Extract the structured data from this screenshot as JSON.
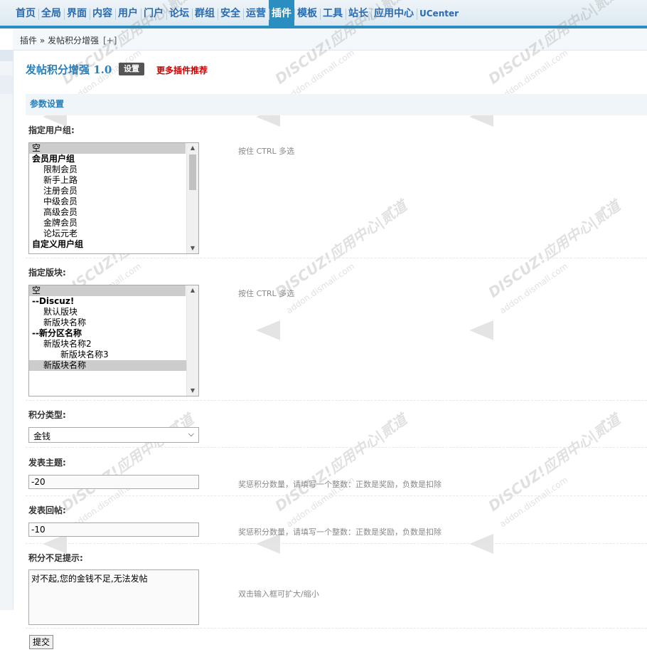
{
  "nav": {
    "items": [
      "首页",
      "全局",
      "界面",
      "内容",
      "用户",
      "门户",
      "论坛",
      "群组",
      "安全",
      "运营",
      "插件",
      "模板",
      "工具",
      "站长",
      "应用中心",
      "UCenter"
    ],
    "active": "插件"
  },
  "breadcrumb": {
    "text": "插件 » 发帖积分增强",
    "plus": "[+]"
  },
  "header": {
    "title": "发帖积分增强 1.0",
    "settings_button": "设置",
    "more_link": "更多插件推荐"
  },
  "section": {
    "title": "参数设置"
  },
  "fields": {
    "usergroups": {
      "label": "指定用户组:",
      "hint": "按住 CTRL 多选",
      "options": [
        {
          "text": "空",
          "level": 0,
          "selected": true,
          "group": false
        },
        {
          "text": "会员用户组",
          "level": 0,
          "selected": false,
          "group": true
        },
        {
          "text": "限制会员",
          "level": 1,
          "selected": false,
          "group": false
        },
        {
          "text": "新手上路",
          "level": 1,
          "selected": false,
          "group": false
        },
        {
          "text": "注册会员",
          "level": 1,
          "selected": false,
          "group": false
        },
        {
          "text": "中级会员",
          "level": 1,
          "selected": false,
          "group": false
        },
        {
          "text": "高级会员",
          "level": 1,
          "selected": false,
          "group": false
        },
        {
          "text": "金牌会员",
          "level": 1,
          "selected": false,
          "group": false
        },
        {
          "text": "论坛元老",
          "level": 1,
          "selected": false,
          "group": false
        },
        {
          "text": "自定义用户组",
          "level": 0,
          "selected": false,
          "group": true
        }
      ]
    },
    "forums": {
      "label": "指定版块:",
      "hint": "按住 CTRL 多选",
      "options": [
        {
          "text": "空",
          "level": 0,
          "selected": true,
          "group": false
        },
        {
          "text": "--Discuz!",
          "level": 0,
          "selected": false,
          "group": true
        },
        {
          "text": "默认版块",
          "level": 1,
          "selected": false,
          "group": false
        },
        {
          "text": "新版块名称",
          "level": 1,
          "selected": false,
          "group": false
        },
        {
          "text": "--新分区名称",
          "level": 0,
          "selected": false,
          "group": true
        },
        {
          "text": "新版块名称2",
          "level": 1,
          "selected": false,
          "group": false
        },
        {
          "text": "新版块名称3",
          "level": 2,
          "selected": false,
          "group": false
        },
        {
          "text": "新版块名称",
          "level": 1,
          "selected": true,
          "group": false
        }
      ]
    },
    "credit_type": {
      "label": "积分类型:",
      "value": "金钱"
    },
    "new_thread": {
      "label": "发表主题:",
      "value": "-20",
      "hint": "奖惩积分数量，请填写一个整数：正数是奖励，负数是扣除"
    },
    "reply": {
      "label": "发表回帖:",
      "value": "-10",
      "hint": "奖惩积分数量，请填写一个整数：正数是奖励，负数是扣除"
    },
    "insufficient": {
      "label": "积分不足提示:",
      "value": "对不起,您的金钱不足,无法发帖",
      "hint": "双击输入框可扩大/缩小"
    }
  },
  "submit_label": "提交"
}
